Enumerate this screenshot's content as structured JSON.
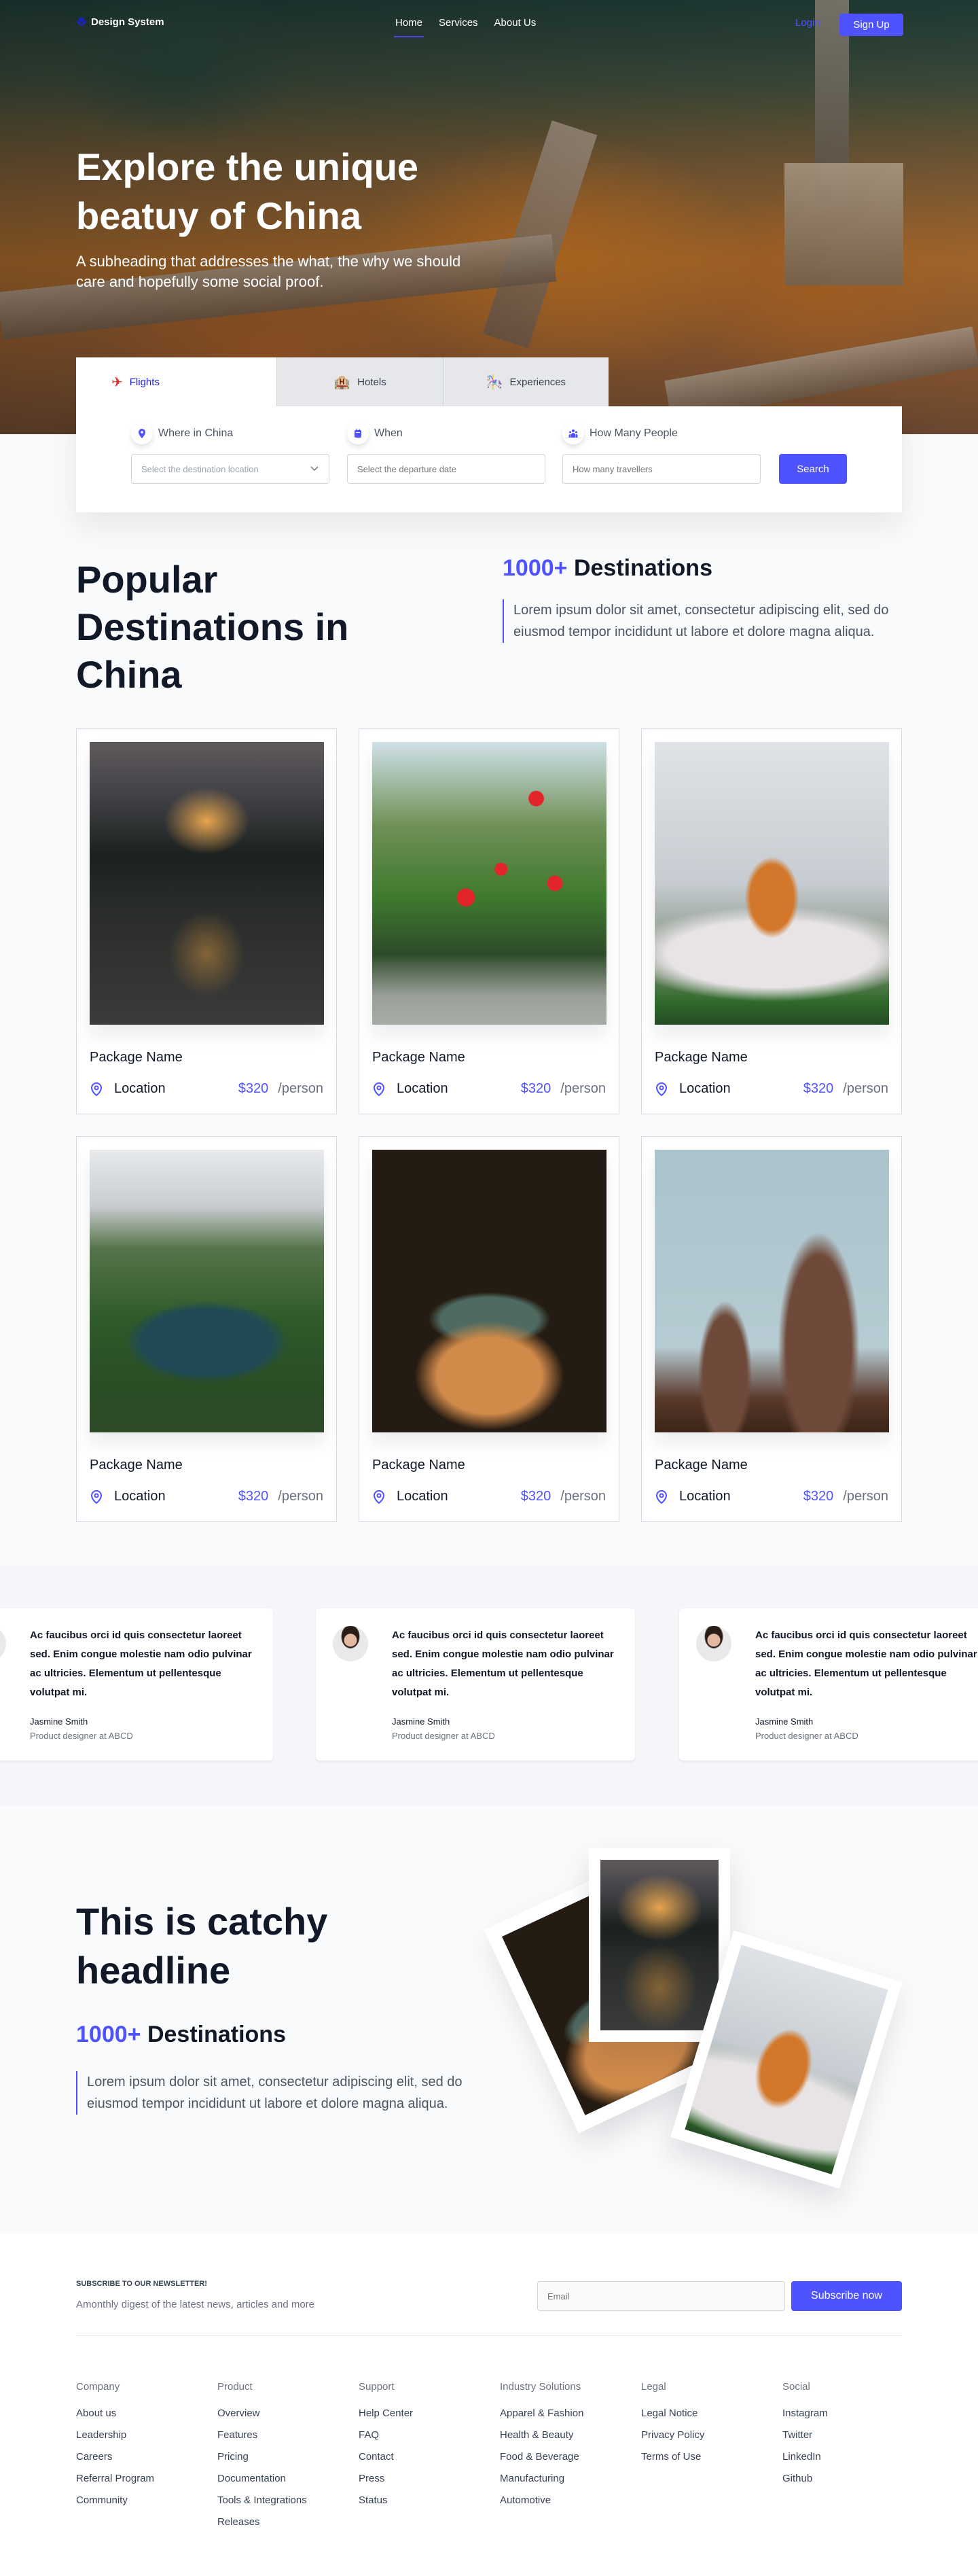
{
  "nav": {
    "brand": "Design System",
    "links": [
      "Home",
      "Services",
      "About Us"
    ],
    "active_link": "Home",
    "login": "Login",
    "signup": "Sign Up"
  },
  "hero": {
    "title": "Explore the unique beatuy of China",
    "subtitle": "A subheading that addresses the what, the why we should care and hopefully some social proof."
  },
  "search": {
    "tabs": [
      {
        "label": "Flights",
        "icon": "airplane-icon",
        "glyph": "✈"
      },
      {
        "label": "Hotels",
        "icon": "hotel-icon",
        "glyph": "🏨"
      },
      {
        "label": "Experiences",
        "icon": "experiences-icon",
        "glyph": "🎠"
      }
    ],
    "active_tab": "Flights",
    "fields": [
      {
        "label": "Where in China",
        "icon": "location-pin-icon",
        "placeholder": "Select the destination location",
        "dropdown": true
      },
      {
        "label": "When",
        "icon": "calendar-icon",
        "placeholder": "Select the departure date"
      },
      {
        "label": "How Many People",
        "icon": "people-icon",
        "placeholder": "How many travellers"
      }
    ],
    "button": "Search"
  },
  "popular": {
    "title": "Popular Destinations in China",
    "count_accent": "1000+",
    "count_label": "Destinations",
    "description": "Lorem ipsum dolor sit amet, consectetur adipiscing elit, sed do eiusmod tempor incididunt ut labore et dolore magna aliqua.",
    "packages": [
      {
        "name": "Package Name",
        "location": "Location",
        "price": "$320",
        "unit": "/person",
        "image": "pavilion-night"
      },
      {
        "name": "Package Name",
        "location": "Location",
        "price": "$320",
        "unit": "/person",
        "image": "red-lanterns-garden"
      },
      {
        "name": "Package Name",
        "location": "Location",
        "price": "$320",
        "unit": "/person",
        "image": "pagoda-cherry-blossoms"
      },
      {
        "name": "Package Name",
        "location": "Location",
        "price": "$320",
        "unit": "/person",
        "image": "mountain-lake"
      },
      {
        "name": "Package Name",
        "location": "Location",
        "price": "$320",
        "unit": "/person",
        "image": "tower-night"
      },
      {
        "name": "Package Name",
        "location": "Location",
        "price": "$320",
        "unit": "/person",
        "image": "church-spires"
      }
    ]
  },
  "testimonials": [
    {
      "quote": "Ac faucibus orci id quis consectetur laoreet sed. Enim congue molestie nam odio pulvinar ac ultricies. Elementum ut pellentesque volutpat mi.",
      "name": "Jasmine Smith",
      "role": "Product designer at ABCD"
    },
    {
      "quote": "Ac faucibus orci id quis consectetur laoreet sed. Enim congue molestie nam odio pulvinar ac ultricies. Elementum ut pellentesque volutpat mi.",
      "name": "Jasmine Smith",
      "role": "Product designer at ABCD"
    },
    {
      "quote": "Ac faucibus orci id quis consectetur laoreet sed. Enim congue molestie nam odio pulvinar ac ultricies. Elementum ut pellentesque volutpat mi.",
      "name": "Jasmine Smith",
      "role": "Product designer at ABCD"
    }
  ],
  "cta": {
    "title": "This is catchy headline",
    "count_accent": "1000+",
    "count_label": "Destinations",
    "description": "Lorem ipsum dolor sit amet, consectetur adipiscing elit, sed do eiusmod tempor incididunt ut labore et dolore magna aliqua."
  },
  "footer": {
    "newsletter_title": "SUBSCRIBE TO OUR NEWSLETTER!",
    "newsletter_sub": "Amonthly digest of the latest news, articles and more",
    "email_placeholder": "Email",
    "subscribe": "Subscribe now",
    "columns": [
      {
        "title": "Company",
        "links": [
          "About us",
          "Leadership",
          "Careers",
          "Referral Program",
          "Community"
        ]
      },
      {
        "title": "Product",
        "links": [
          "Overview",
          "Features",
          "Pricing",
          "Documentation",
          "Tools & Integrations",
          "Releases"
        ]
      },
      {
        "title": "Support",
        "links": [
          "Help Center",
          "FAQ",
          "Contact",
          "Press",
          "Status"
        ]
      },
      {
        "title": "Industry Solutions",
        "links": [
          "Apparel & Fashion",
          "Health & Beauty",
          "Food & Beverage",
          "Manufacturing",
          "Automotive"
        ]
      },
      {
        "title": "Legal",
        "links": [
          "Legal Notice",
          "Privacy Policy",
          "Terms of Use"
        ]
      },
      {
        "title": "Social",
        "links": [
          "Instagram",
          "Twitter",
          "LinkedIn",
          "Github"
        ]
      }
    ]
  },
  "colors": {
    "accent": "#4f52ff",
    "heading": "#111827",
    "body": "#4b5563",
    "muted": "#6b7280"
  }
}
